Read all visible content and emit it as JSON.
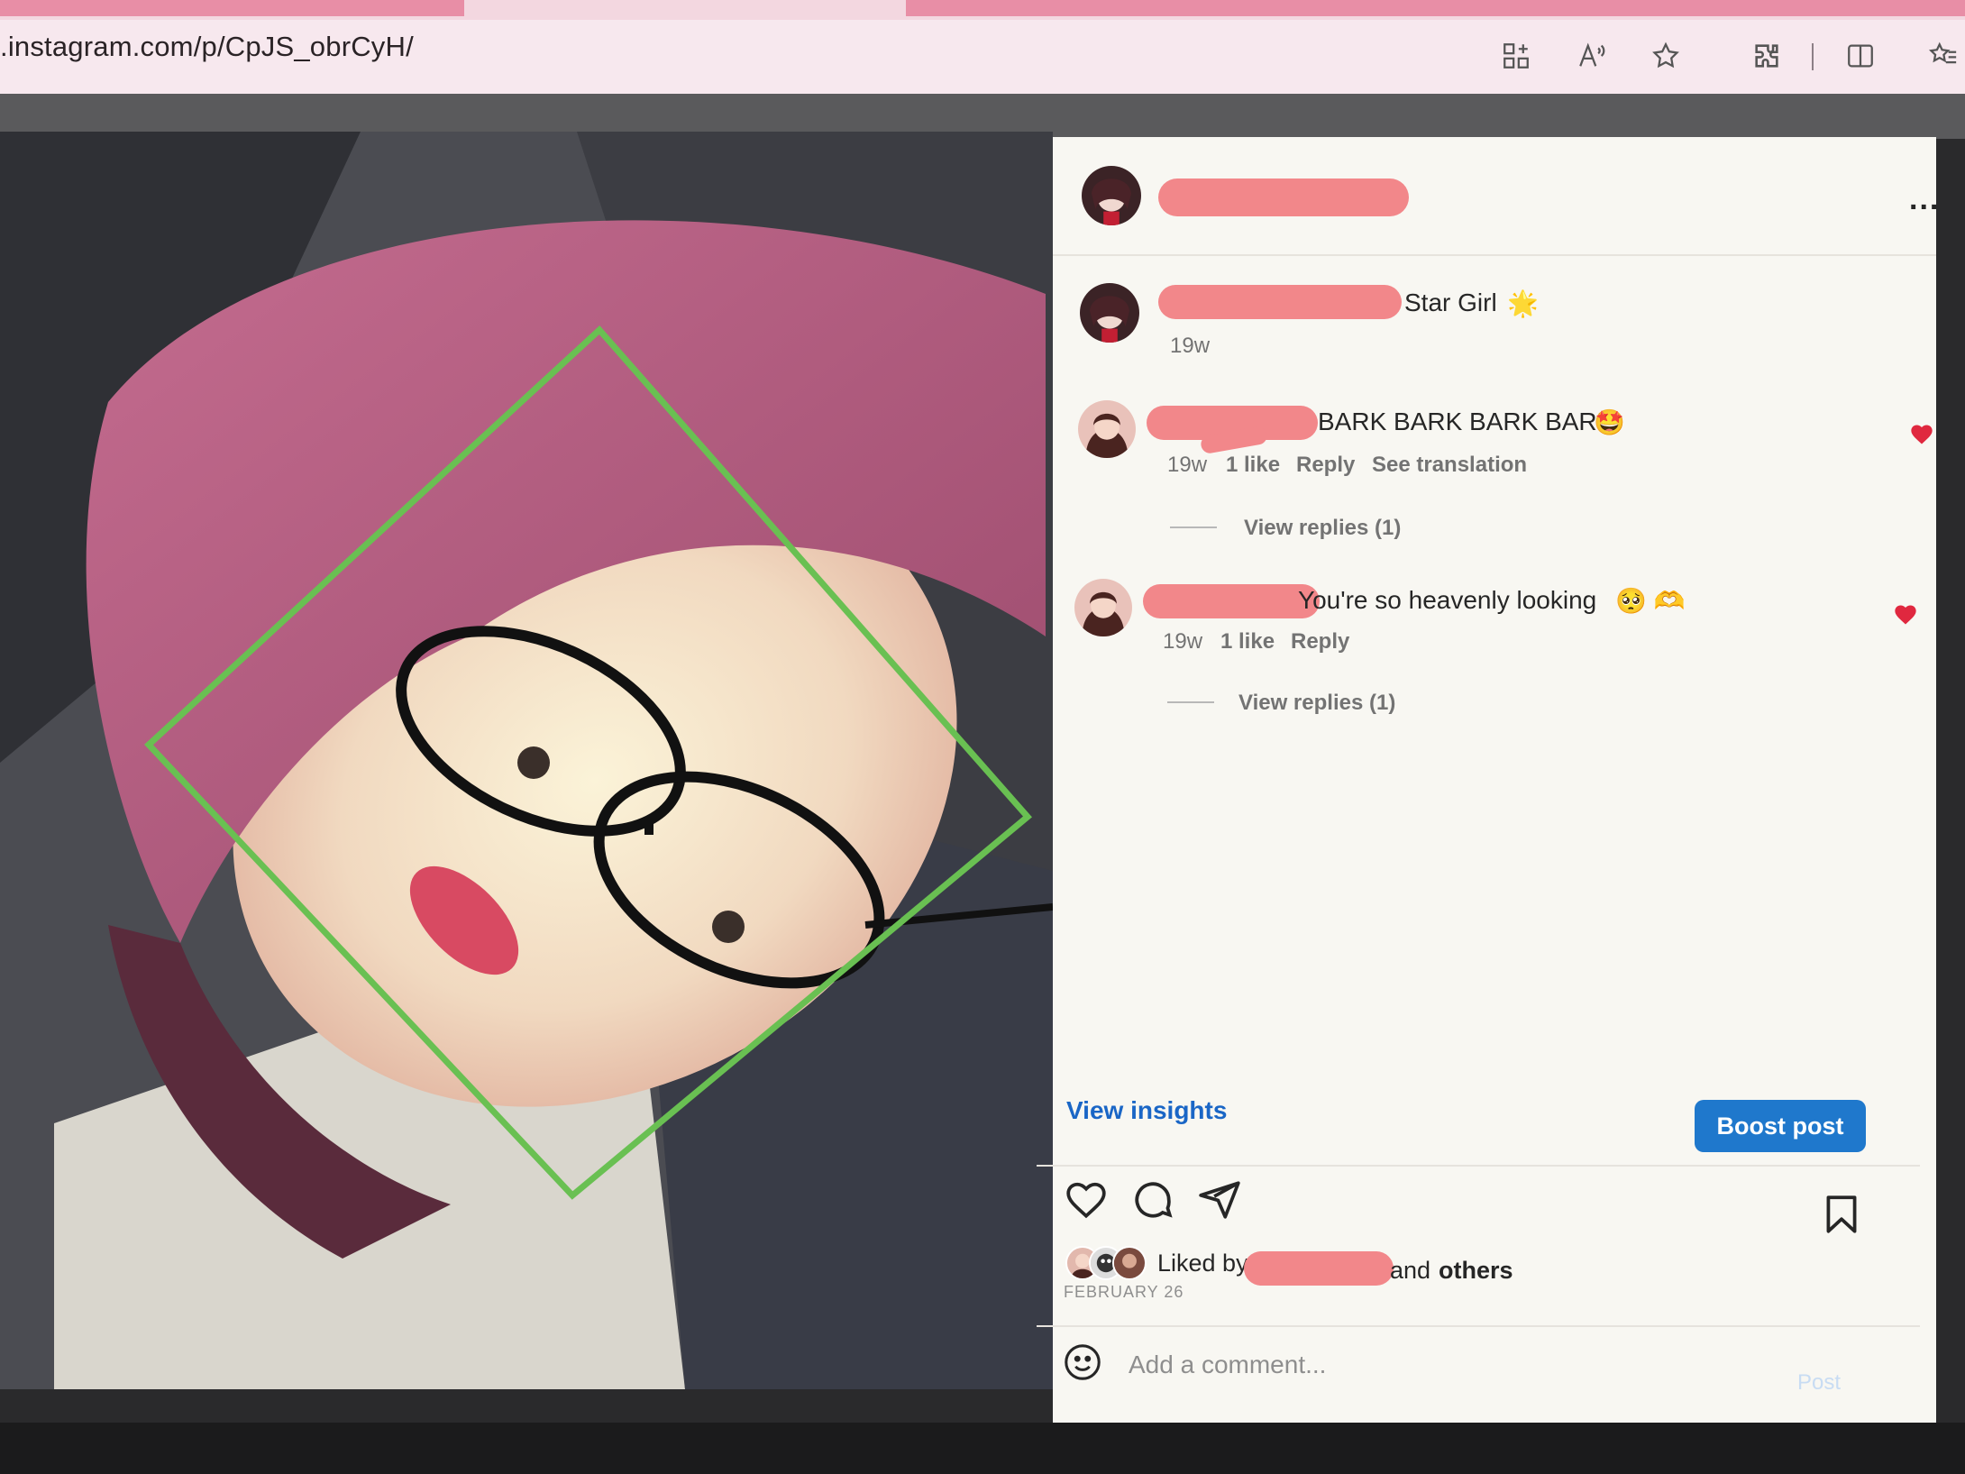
{
  "browser": {
    "url": ".instagram.com/p/CpJS_obrCyH/",
    "toolbar_icons": [
      "apps-icon",
      "read-aloud-icon",
      "favorite-star-icon",
      "extensions-icon",
      "split-screen-icon",
      "favorites-list-icon"
    ]
  },
  "post": {
    "header": {
      "more_label": "..."
    },
    "caption": {
      "text": "Star Girl",
      "emoji": "🌟",
      "time": "19w"
    },
    "comments": [
      {
        "text": "BARK BARK BARK BARK",
        "emoji": "🤩",
        "time": "19w",
        "likes": "1 like",
        "reply": "Reply",
        "translate": "See translation",
        "view_replies": "View replies (1)"
      },
      {
        "text": "You're so heavenly looking",
        "emoji": "🥺 🫶",
        "time": "19w",
        "likes": "1 like",
        "reply": "Reply",
        "view_replies": "View replies (1)"
      }
    ],
    "view_insights": "View insights",
    "boost": "Boost post",
    "liked_by_prefix": "Liked by",
    "liked_by_suffix_and": "and",
    "liked_by_suffix_others": "others",
    "date": "FEBRUARY 26",
    "comment_placeholder": "Add a comment...",
    "post_label": "Post"
  },
  "colors": {
    "accent": "#1f78cc",
    "redaction": "#f2878a",
    "heart": "#e0283f",
    "diamond": "#69c052"
  }
}
